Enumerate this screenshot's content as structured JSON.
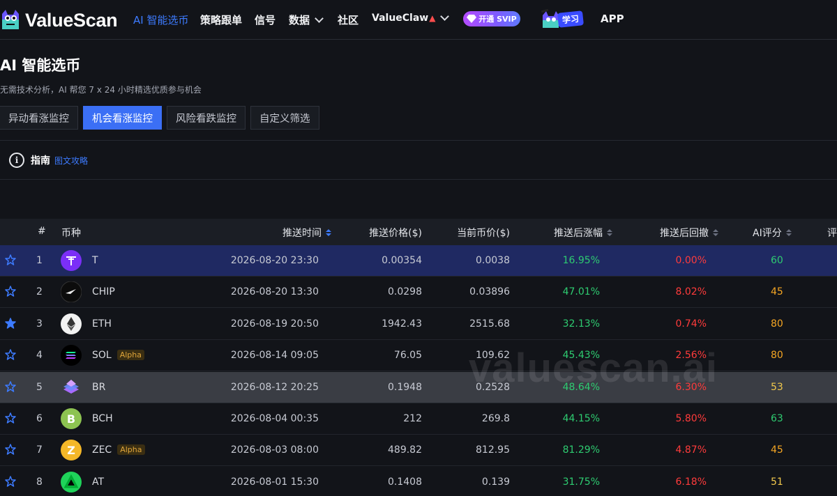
{
  "nav": {
    "brand": "ValueScan",
    "items": [
      "AI 智能选币",
      "策略跟单",
      "信号",
      "数据",
      "社区",
      "ValueClaw",
      "APP"
    ],
    "svip": "开通 SVIP",
    "learn": "学习"
  },
  "page": {
    "title": "AI 智能选币",
    "subtitle": "无需技术分析，AI 帮您 7 x 24 小时精选优质参与机会",
    "tabs": [
      "异动看涨监控",
      "机会看涨监控",
      "风险看跌监控",
      "自定义筛选"
    ],
    "active_tab": "机会看涨监控"
  },
  "guide": {
    "icon": "i",
    "label": "指南",
    "link": "图文攻略"
  },
  "table": {
    "headers": {
      "num": "#",
      "coin": "币种",
      "time": "推送时间",
      "push_price": "推送价格($)",
      "cur_price": "当前币价($)",
      "gain": "推送后涨幅",
      "drawdown": "推送后回撤",
      "score": "AI评分",
      "extra": "评"
    },
    "badge": "Alpha",
    "rows": [
      {
        "n": "1",
        "sym": "T",
        "time": "2026-08-20 23:30",
        "push": "0.00354",
        "cur": "0.0038",
        "gain": "16.95%",
        "dd": "0.00%",
        "score": "60",
        "icon": "t-token-icon"
      },
      {
        "n": "2",
        "sym": "CHIP",
        "time": "2026-08-20 13:30",
        "push": "0.0298",
        "cur": "0.03896",
        "gain": "47.01%",
        "dd": "8.02%",
        "score": "45",
        "icon": "chip-token-icon"
      },
      {
        "n": "3",
        "sym": "ETH",
        "time": "2026-08-19 20:50",
        "push": "1942.43",
        "cur": "2515.68",
        "gain": "32.13%",
        "dd": "0.74%",
        "score": "80",
        "icon": "eth-icon"
      },
      {
        "n": "4",
        "sym": "SOL",
        "time": "2026-08-14 09:05",
        "push": "76.05",
        "cur": "109.62",
        "gain": "45.43%",
        "dd": "2.56%",
        "score": "80",
        "icon": "sol-icon"
      },
      {
        "n": "5",
        "sym": "BR",
        "time": "2026-08-12 20:25",
        "push": "0.1948",
        "cur": "0.2528",
        "gain": "48.64%",
        "dd": "6.30%",
        "score": "53",
        "icon": "br-token-icon"
      },
      {
        "n": "6",
        "sym": "BCH",
        "time": "2026-08-04 00:35",
        "push": "212",
        "cur": "269.8",
        "gain": "44.15%",
        "dd": "5.80%",
        "score": "63",
        "icon": "bch-icon"
      },
      {
        "n": "7",
        "sym": "ZEC",
        "time": "2026-08-03 08:00",
        "push": "489.82",
        "cur": "812.95",
        "gain": "81.29%",
        "dd": "4.87%",
        "score": "45",
        "icon": "zec-icon"
      },
      {
        "n": "8",
        "sym": "AT",
        "time": "2026-08-01 15:30",
        "push": "0.1408",
        "cur": "0.139",
        "gain": "31.75%",
        "dd": "6.18%",
        "score": "51",
        "icon": "at-token-icon"
      }
    ]
  },
  "watermark": "valuescan.ai",
  "colors": {
    "accent": "#3b6ff5",
    "positive": "#2ecc71",
    "negative": "#ff3b3b",
    "score_green": "#2ecc71",
    "score_orange": "#f5a623",
    "score_yellow": "#f2c94c"
  }
}
